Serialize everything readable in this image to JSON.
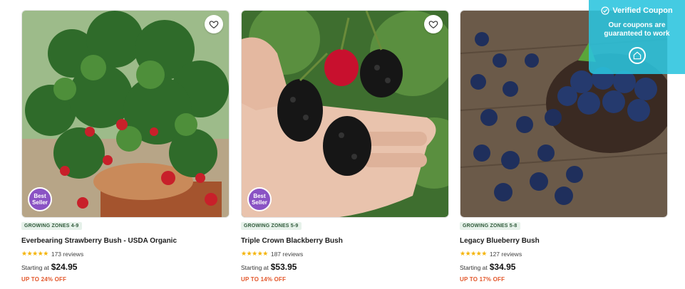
{
  "products": [
    {
      "zone": "GROWING ZONES 4-9",
      "title": "Everbearing Strawberry Bush - USDA Organic",
      "stars": "★★★★★",
      "reviews": "173 reviews",
      "starting_label": "Starting at",
      "price": "$24.95",
      "discount": "UP TO 24% OFF",
      "badge_line1": "Best",
      "badge_line2": "Seller",
      "icon": "heart-icon"
    },
    {
      "zone": "GROWING ZONES 5-9",
      "title": "Triple Crown Blackberry Bush",
      "stars": "★★★★★",
      "reviews": "187 reviews",
      "starting_label": "Starting at",
      "price": "$53.95",
      "discount": "UP TO 14% OFF",
      "badge_line1": "Best",
      "badge_line2": "Seller",
      "icon": "heart-icon"
    },
    {
      "zone": "GROWING ZONES 5-8",
      "title": "Legacy Blueberry Bush",
      "stars": "★★★★★",
      "reviews": "127 reviews",
      "starting_label": "Starting at",
      "price": "$34.95",
      "discount": "UP TO 17% OFF",
      "icon": "heart-icon"
    }
  ],
  "coupon": {
    "title": "Verified Coupon",
    "line1": "Our coupons are",
    "line2": "guaranteed to work",
    "icon": "coupon-tag-icon",
    "color": "#2ac4de"
  },
  "colors": {
    "zone_bg": "#e6f1ea",
    "discount": "#e2562a",
    "star": "#f5b301",
    "badge": "#8a53c4"
  }
}
